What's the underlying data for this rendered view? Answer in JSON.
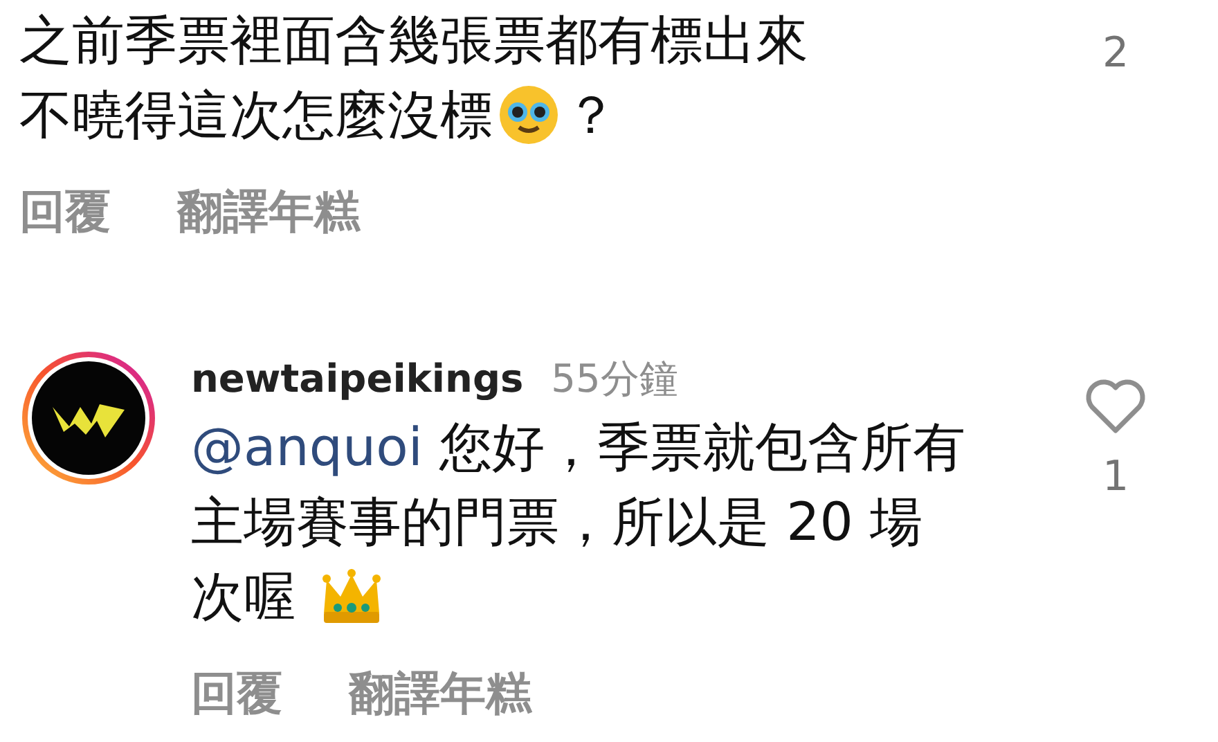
{
  "comments": [
    {
      "lines": [
        [
          {
            "kind": "text",
            "text": "之前季票裡面含幾張票都有標出來"
          }
        ],
        [
          {
            "kind": "text",
            "text": "不曉得這次怎麼沒標"
          },
          {
            "kind": "pleading"
          },
          {
            "kind": "text",
            "text": "？"
          }
        ]
      ],
      "actions": [
        "回覆",
        "翻譯年糕"
      ],
      "like_count": "2"
    },
    {
      "username": "newtaipeikings",
      "time": "55分鐘",
      "lines": [
        [
          {
            "kind": "mention",
            "text": "@anquoi"
          },
          {
            "kind": "text",
            "text": " 您好，季票就包含所有"
          }
        ],
        [
          {
            "kind": "text",
            "text": "主場賽事的門票，所以是 20 場"
          }
        ],
        [
          {
            "kind": "text",
            "text": "次喔 "
          },
          {
            "kind": "crown"
          }
        ]
      ],
      "actions": [
        "回覆",
        "翻譯年糕"
      ],
      "liked": false,
      "like_count": "1"
    }
  ]
}
